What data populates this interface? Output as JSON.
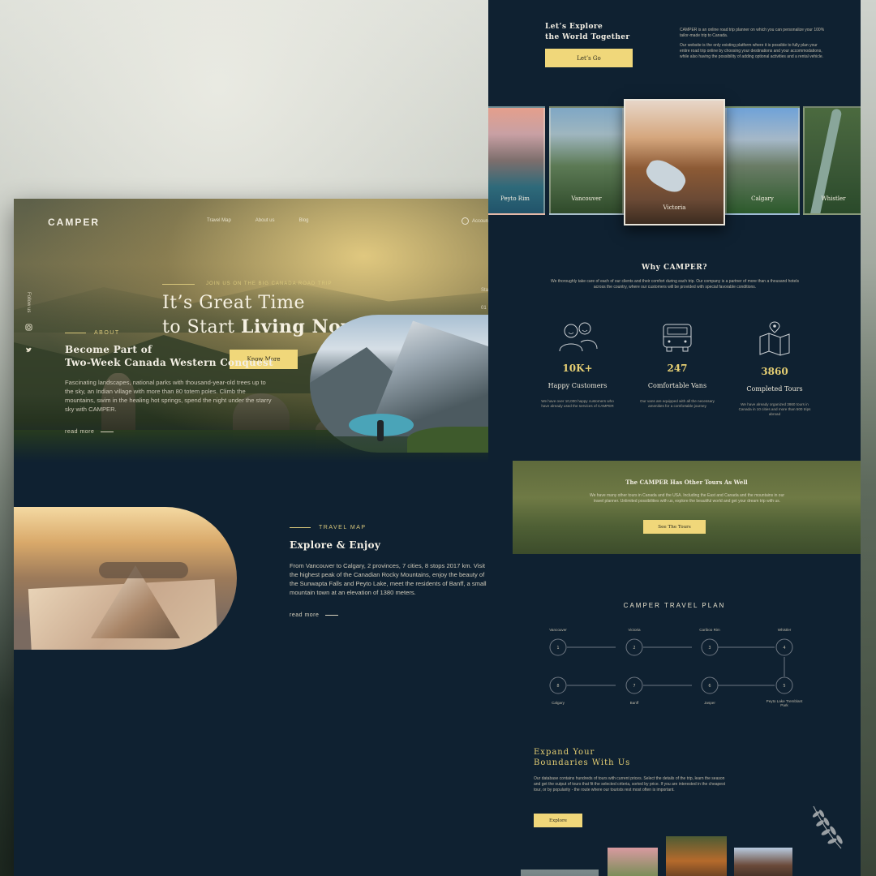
{
  "colors": {
    "navy": "#0f2131",
    "gold": "#f0d77a",
    "gold_text": "#d8c77b",
    "stat_gold": "#e6cf73"
  },
  "nav": {
    "logo": "CAMPER",
    "links": [
      "Travel Map",
      "About us",
      "Blog"
    ],
    "account": "Account",
    "account_icon": "user-circle-icon"
  },
  "social": {
    "follow": "Follow us",
    "icons": [
      "instagram-icon",
      "twitter-icon"
    ]
  },
  "hero": {
    "tagline": "JOIN US ON THE BIG CANADA ROAD TRIP",
    "title_line1": "It’s Great Time",
    "title_line2_prefix": "to Start ",
    "title_line2_bold": "Living Now",
    "button": "Know More",
    "slides": [
      "Start",
      "01",
      "02",
      "03"
    ]
  },
  "about": {
    "tag": "ABOUT",
    "title_line1": "Become Part of",
    "title_line2": "Two-Week Canada Western Conquest",
    "body": "Fascinating landscapes, national parks with thousand-year-old trees up to the sky, an Indian village with more than 80 totem poles. Climb the mountains, swim in the healing hot springs, spend the night under the starry sky with CAMPER.",
    "read_more": "read more"
  },
  "travel_map": {
    "tag": "TRAVEL MAP",
    "title": "Explore & Enjoy",
    "body": "From Vancouver to Calgary, 2 provinces, 7 cities, 8 stops 2017 km. Visit the highest peak of the Canadian Rocky Mountains, enjoy the beauty of the Sunwapta Falls and Peyto Lake, meet the residents of Banff, a small mountain town at an elevation of 1380 meters.",
    "read_more": "read more"
  },
  "explore": {
    "title_line1": "Let’s Explore",
    "title_line2": "the World Together",
    "button": "Let’s Go",
    "desc1": "CAMPER is an online road trip planner on which you can personalize your 100% tailor-made trip to Canada.",
    "desc2": "Our website is the only existing platform where it is possible to fully plan your entire road trip online by choosing your destinations and your accommodations, while also having the possibility of adding optional activities and a rental vehicle."
  },
  "destinations": [
    "Peyto Rim",
    "Vancouver",
    "Victoria",
    "Calgary",
    "Whistler"
  ],
  "why": {
    "title": "Why CAMPER?",
    "desc": "We thoroughly take care of each of our clients and their comfort during each trip. Our company is a partner of more than a thousand hotels across the country, where our customers will be provided with special favorable conditions.",
    "stats": [
      {
        "icon": "happy-people-icon",
        "value": "10K+",
        "label": "Happy Customers",
        "desc": "We have over 10,000 happy customers who have already used the services of CAMPER"
      },
      {
        "icon": "van-icon",
        "value": "247",
        "label": "Comfortable Vans",
        "desc": "Our vans are equipped with all the necessary amenities for a comfortable journey"
      },
      {
        "icon": "map-pin-icon",
        "value": "3860",
        "label": "Completed Tours",
        "desc": "We have already organized 3860 tours in Canada in 10 cities and more than 500 trips abroad"
      }
    ]
  },
  "other_tours": {
    "title": "The CAMPER Has Other Tours As Well",
    "desc": "We have many other tours in Canada and the USA. Including the East and Canada and the mountains in our travel planner. Unlimited possibilities with us, explore the beautiful world and get your dream trip with us.",
    "button": "See The Tours"
  },
  "plan": {
    "title": "CAMPER TRAVEL PLAN",
    "top_labels": [
      "Vancouver",
      "Victoria",
      "Cariboo Rim",
      "Whistler"
    ],
    "top_numbers": [
      "1",
      "2",
      "3",
      "4"
    ],
    "bottom_labels": [
      "Calgary",
      "Banff",
      "Jasper",
      "Peyto Lake Tremblant Park"
    ],
    "bottom_numbers": [
      "8",
      "7",
      "6",
      "5"
    ]
  },
  "expand": {
    "title_line1": "Expand Your",
    "title_line2": "Boundaries With Us",
    "desc": "Our database contains hundreds of tours with current prices. Select the details of the trip, learn the season and get the output of tours that fit the selected criteria, sorted by price. If you are interested in the cheapest tour, or by popularity - the route where our tourists rest most often is important.",
    "button": "Explore",
    "decor_icon": "laurel-leaf-icon"
  }
}
